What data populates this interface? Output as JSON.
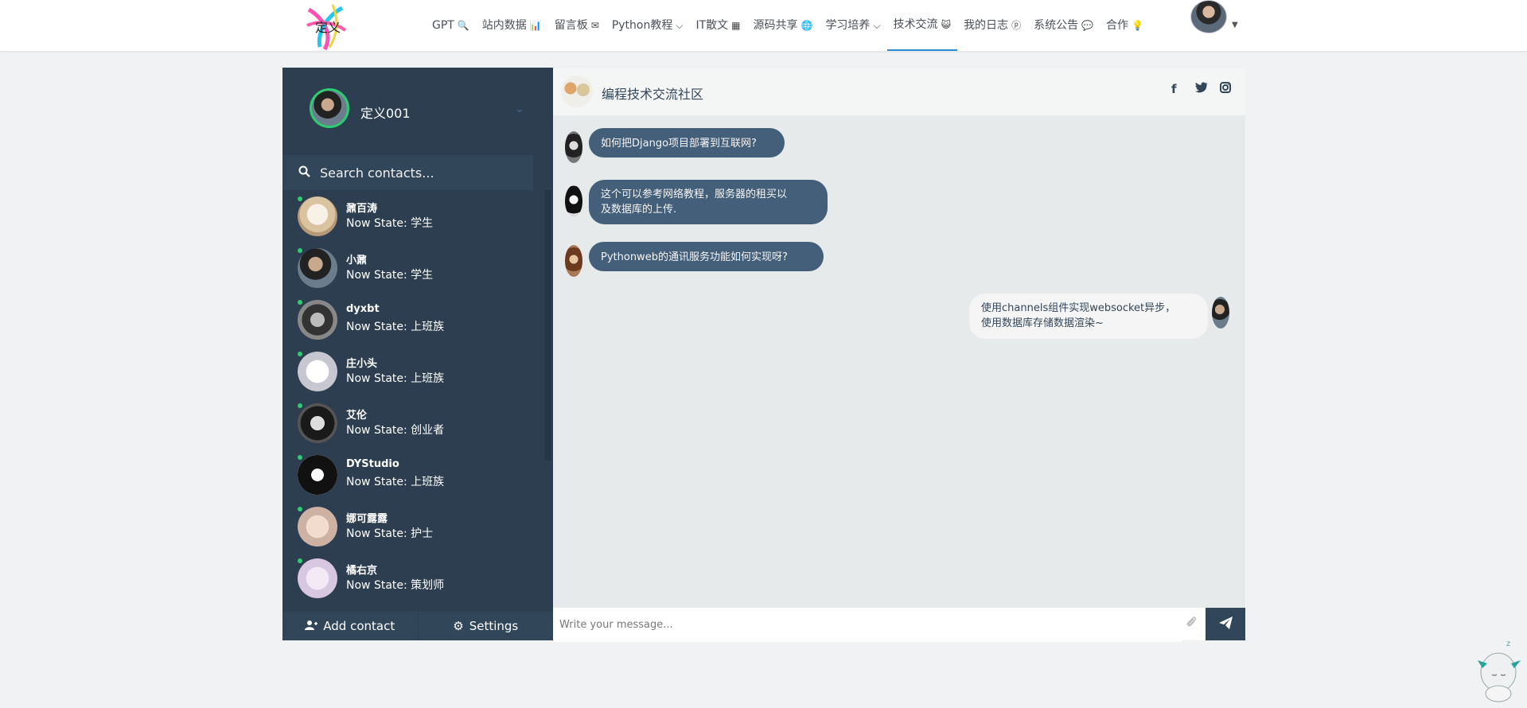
{
  "nav": {
    "items": [
      {
        "label": "GPT",
        "icon": "🔍"
      },
      {
        "label": "站内数据",
        "icon": "📊"
      },
      {
        "label": "留言板",
        "icon": "✉"
      },
      {
        "label": "Python教程",
        "icon": "⌵"
      },
      {
        "label": "IT散文",
        "icon": "▦"
      },
      {
        "label": "源码共享",
        "icon": "🌐"
      },
      {
        "label": "学习培养",
        "icon": "⌵"
      },
      {
        "label": "技术交流",
        "icon": "😺"
      },
      {
        "label": "我的日志",
        "icon": "ⓟ"
      },
      {
        "label": "系统公告",
        "icon": "💬"
      },
      {
        "label": "合作",
        "icon": "💡"
      }
    ],
    "active_index": 7,
    "logo_text": "定义"
  },
  "profile": {
    "name": "定义001"
  },
  "search": {
    "placeholder": "Search contacts..."
  },
  "contacts": [
    {
      "name": "鼐百涛",
      "state": "Now State: 学生"
    },
    {
      "name": "小鼐",
      "state": "Now State: 学生"
    },
    {
      "name": "dyxbt",
      "state": "Now State: 上班族"
    },
    {
      "name": "庄小头",
      "state": "Now State: 上班族"
    },
    {
      "name": "艾伦",
      "state": "Now State: 创业者"
    },
    {
      "name": "DYStudio",
      "state": "Now State: 上班族"
    },
    {
      "name": "娜可露露",
      "state": "Now State: 护士"
    },
    {
      "name": "橘右京",
      "state": "Now State: 策划师"
    }
  ],
  "bottom": {
    "add_contact": "Add contact",
    "settings": "Settings"
  },
  "chat": {
    "title": "编程技术交流社区",
    "messages": [
      {
        "type": "sent",
        "text": "如何把Django项目部署到互联网?"
      },
      {
        "type": "sent",
        "text_line1": "这个可以参考网络教程，服务器的租买以",
        "text_line2": "及数据库的上传."
      },
      {
        "type": "sent",
        "text": "Pythonweb的通讯服务功能如何实现呀?"
      },
      {
        "type": "replied",
        "text_line1": "使用channels组件实现websocket异步，",
        "text_line2": "使用数据库存储数据渲染~"
      }
    ],
    "composer_placeholder": "Write your message..."
  },
  "colors": {
    "sidebar": "#2c3e50",
    "sent_bubble": "#435f7a",
    "online": "#2ecc71",
    "active_nav": "#2b8dd6"
  },
  "icons": [
    "search-icon",
    "chevron-down-icon",
    "user-plus-icon",
    "gear-icon",
    "facebook-icon",
    "twitter-icon",
    "instagram-icon",
    "paperclip-icon",
    "send-icon"
  ]
}
